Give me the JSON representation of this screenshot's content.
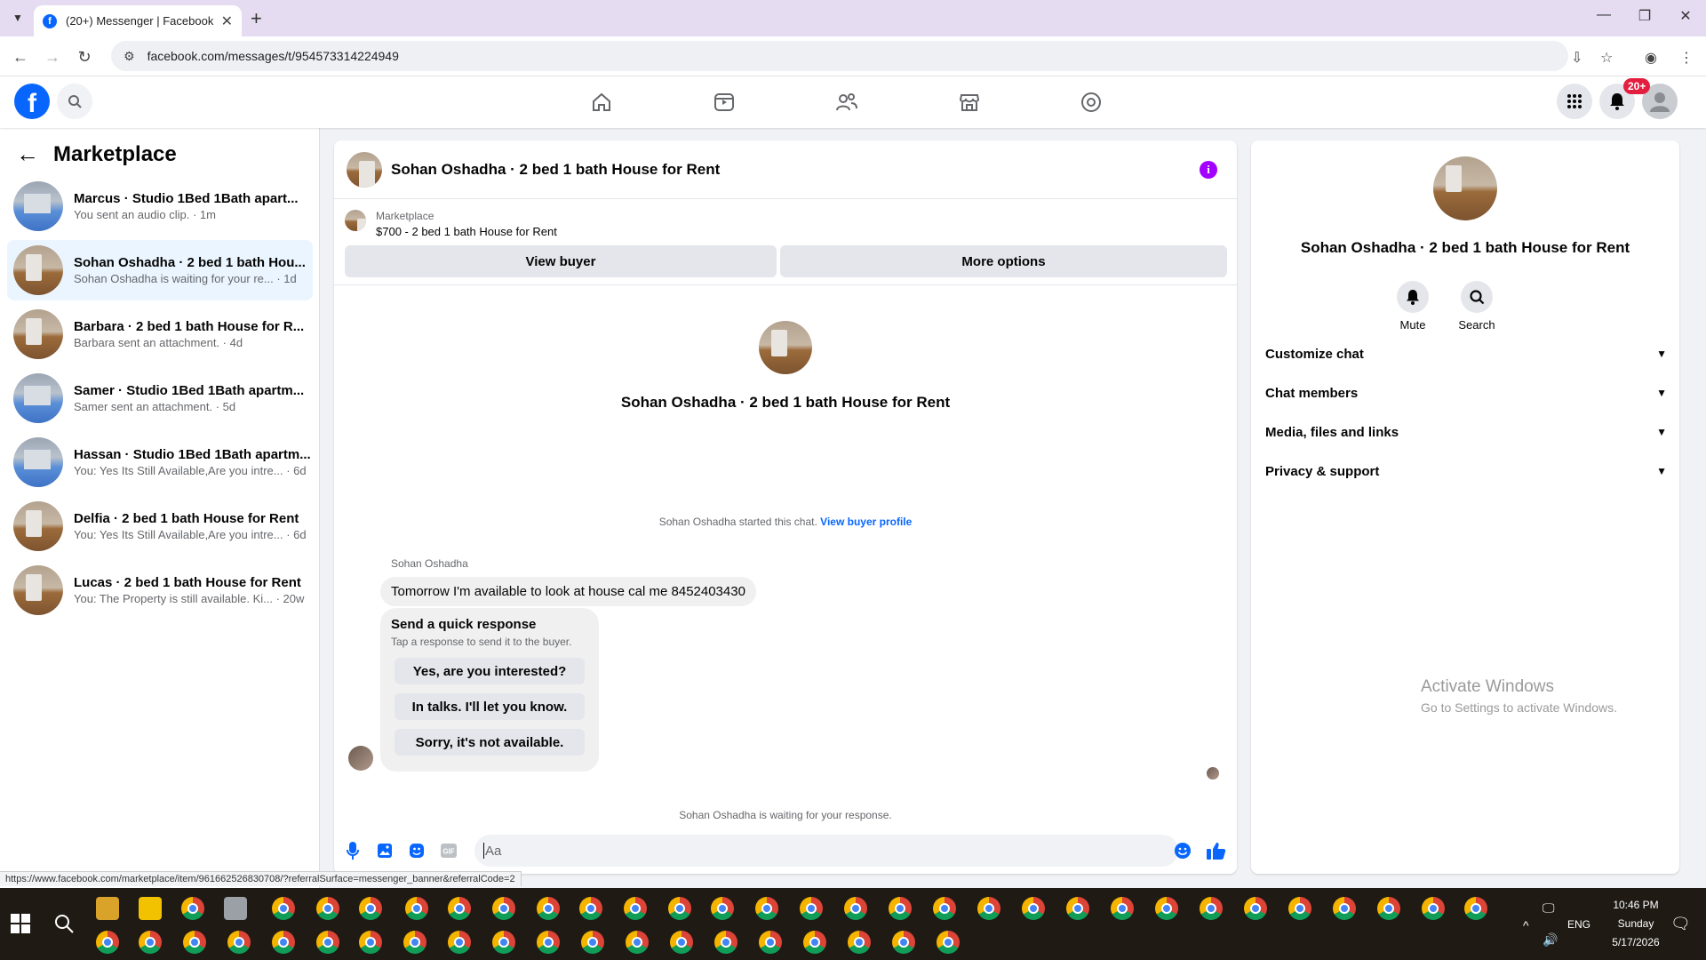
{
  "browser": {
    "tab_title": "(20+) Messenger | Facebook",
    "url": "facebook.com/messages/t/954573314224949",
    "status_url": "https://www.facebook.com/marketplace/item/961662526830708/?referralSurface=messenger_banner&referralCode=2"
  },
  "fb": {
    "notif_badge": "20+"
  },
  "sidebar": {
    "title": "Marketplace",
    "conversations": [
      {
        "name": "Marcus · Studio 1Bed 1Bath apart...",
        "preview": "You sent an audio clip. · 1m",
        "thumb": "studio"
      },
      {
        "name": "Sohan Oshadha · 2 bed 1 bath Hou...",
        "preview": "Sohan Oshadha is waiting for your re... · 1d",
        "thumb": "house"
      },
      {
        "name": "Barbara · 2 bed 1 bath House for R...",
        "preview": "Barbara sent an attachment. · 4d",
        "thumb": "house"
      },
      {
        "name": "Samer · Studio 1Bed 1Bath apartm...",
        "preview": "Samer sent an attachment. · 5d",
        "thumb": "studio"
      },
      {
        "name": "Hassan · Studio 1Bed 1Bath apartm...",
        "preview": "You: Yes Its Still Available,Are you intre... · 6d",
        "thumb": "studio"
      },
      {
        "name": "Delfia · 2 bed 1 bath House for Rent",
        "preview": "You: Yes Its Still Available,Are you intre... · 6d",
        "thumb": "house"
      },
      {
        "name": "Lucas · 2 bed 1 bath House for Rent",
        "preview": "You: The Property is still available. Ki... · 20w",
        "thumb": "house"
      }
    ]
  },
  "chat": {
    "title": "Sohan Oshadha · 2 bed 1 bath House for Rent",
    "banner_label": "Marketplace",
    "banner_item": "$700 - 2 bed 1 bath House for Rent",
    "view_buyer": "View buyer",
    "more_options": "More options",
    "intro_name": "Sohan Oshadha · 2 bed 1 bath House for Rent",
    "started_text": "Sohan Oshadha started this chat.",
    "view_buyer_profile": "View buyer profile",
    "sender": "Sohan Oshadha",
    "message": "Tomorrow I'm available to look at house cal me 8452403430",
    "quick_title": "Send a quick response",
    "quick_sub": "Tap a response to send it to the buyer.",
    "quick_responses": [
      "Yes, are you interested?",
      "In talks. I'll let you know.",
      "Sorry, it's not available."
    ],
    "waiting": "Sohan Oshadha is waiting for your response.",
    "composer_placeholder": "Aa"
  },
  "info": {
    "name": "Sohan Oshadha · 2 bed 1 bath House for Rent",
    "mute": "Mute",
    "search": "Search",
    "sections": [
      "Customize chat",
      "Chat members",
      "Media, files and links",
      "Privacy & support"
    ]
  },
  "watermark": {
    "line1": "Activate Windows",
    "line2": "Go to Settings to activate Windows."
  },
  "taskbar": {
    "time": "10:46 PM",
    "day": "Sunday",
    "date": "5/17/2026",
    "lang": "ENG"
  }
}
